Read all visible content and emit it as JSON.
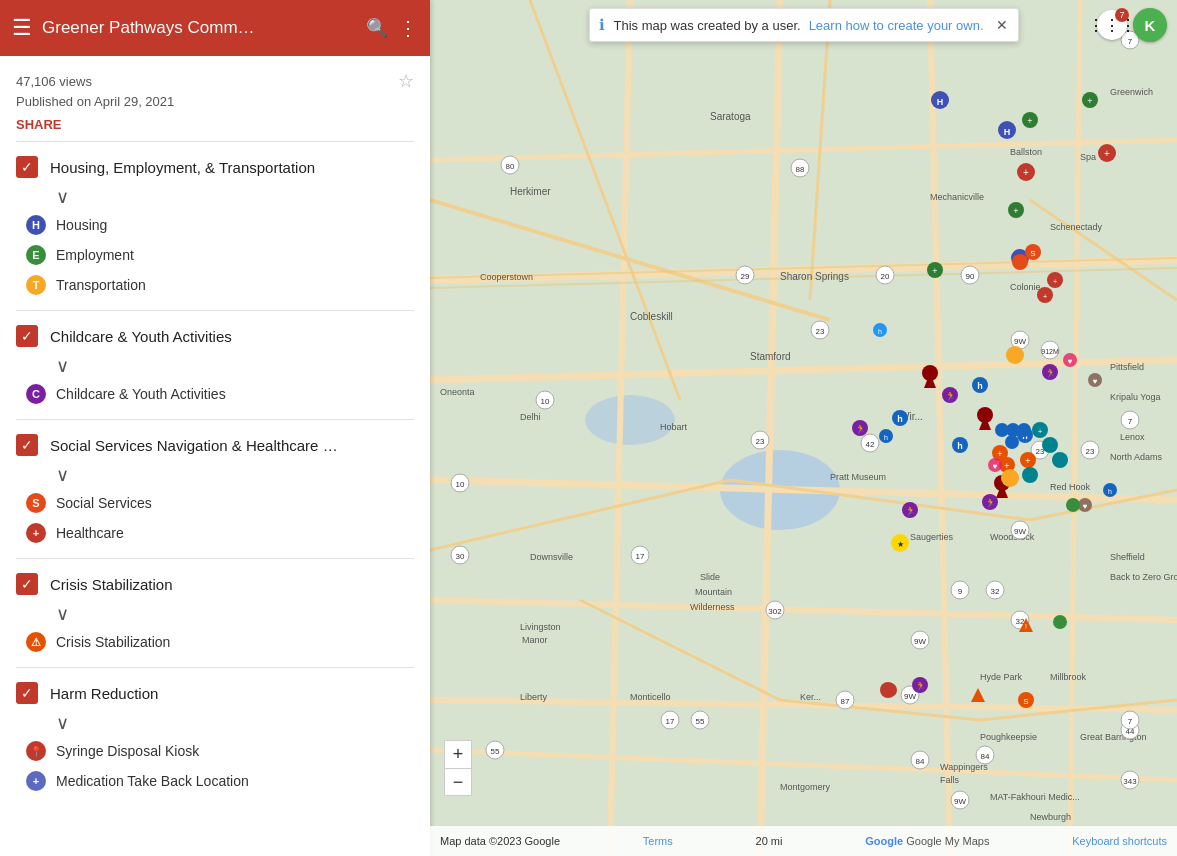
{
  "topbar": {
    "menu_label": "☰",
    "title": "Greener Pathways Comm…",
    "search_label": "🔍",
    "dots_label": "⋮"
  },
  "meta": {
    "views": "47,106 views",
    "published": "Published on April 29, 2021",
    "share_label": "SHARE",
    "star_icon": "☆"
  },
  "notif": {
    "info_icon": "ℹ",
    "text": "This map was created by a user.",
    "link_text": "Learn how to create your own.",
    "close_icon": "✕"
  },
  "categories": [
    {
      "id": "housing-employment-transportation",
      "title": "Housing, Employment, & Transportation",
      "checked": true,
      "items": [
        {
          "label": "Housing",
          "color": "#3F51B5",
          "symbol": "H"
        },
        {
          "label": "Employment",
          "color": "#388E3C",
          "symbol": "E"
        },
        {
          "label": "Transportation",
          "color": "#F9A825",
          "symbol": "T"
        }
      ]
    },
    {
      "id": "childcare-youth",
      "title": "Childcare & Youth Activities",
      "checked": true,
      "items": [
        {
          "label": "Childcare & Youth Activities",
          "color": "#7B1FA2",
          "symbol": "C"
        }
      ]
    },
    {
      "id": "social-services-healthcare",
      "title": "Social Services Navigation & Healthcare …",
      "checked": true,
      "items": [
        {
          "label": "Social Services",
          "color": "#E64A19",
          "symbol": "S"
        },
        {
          "label": "Healthcare",
          "color": "#c0392b",
          "symbol": "+"
        }
      ]
    },
    {
      "id": "crisis-stabilization",
      "title": "Crisis Stabilization",
      "checked": true,
      "items": [
        {
          "label": "Crisis Stabilization",
          "color": "#E65100",
          "symbol": "⚠"
        }
      ]
    },
    {
      "id": "harm-reduction",
      "title": "Harm Reduction",
      "checked": true,
      "items": [
        {
          "label": "Syringe Disposal Kiosk",
          "color": "#c0392b",
          "symbol": "📍"
        },
        {
          "label": "Medication Take Back Location",
          "color": "#5C6BC0",
          "symbol": "+"
        }
      ]
    }
  ],
  "map": {
    "bottom_text": "Map data ©2023 Google",
    "terms_label": "Terms",
    "scale_label": "20 mi",
    "keyboard_shortcuts": "Keyboard shortcuts",
    "google_label": "Google My Maps"
  },
  "user": {
    "avatar_initials": "K",
    "notification_count": "7"
  },
  "zoom": {
    "plus": "+",
    "minus": "−"
  }
}
